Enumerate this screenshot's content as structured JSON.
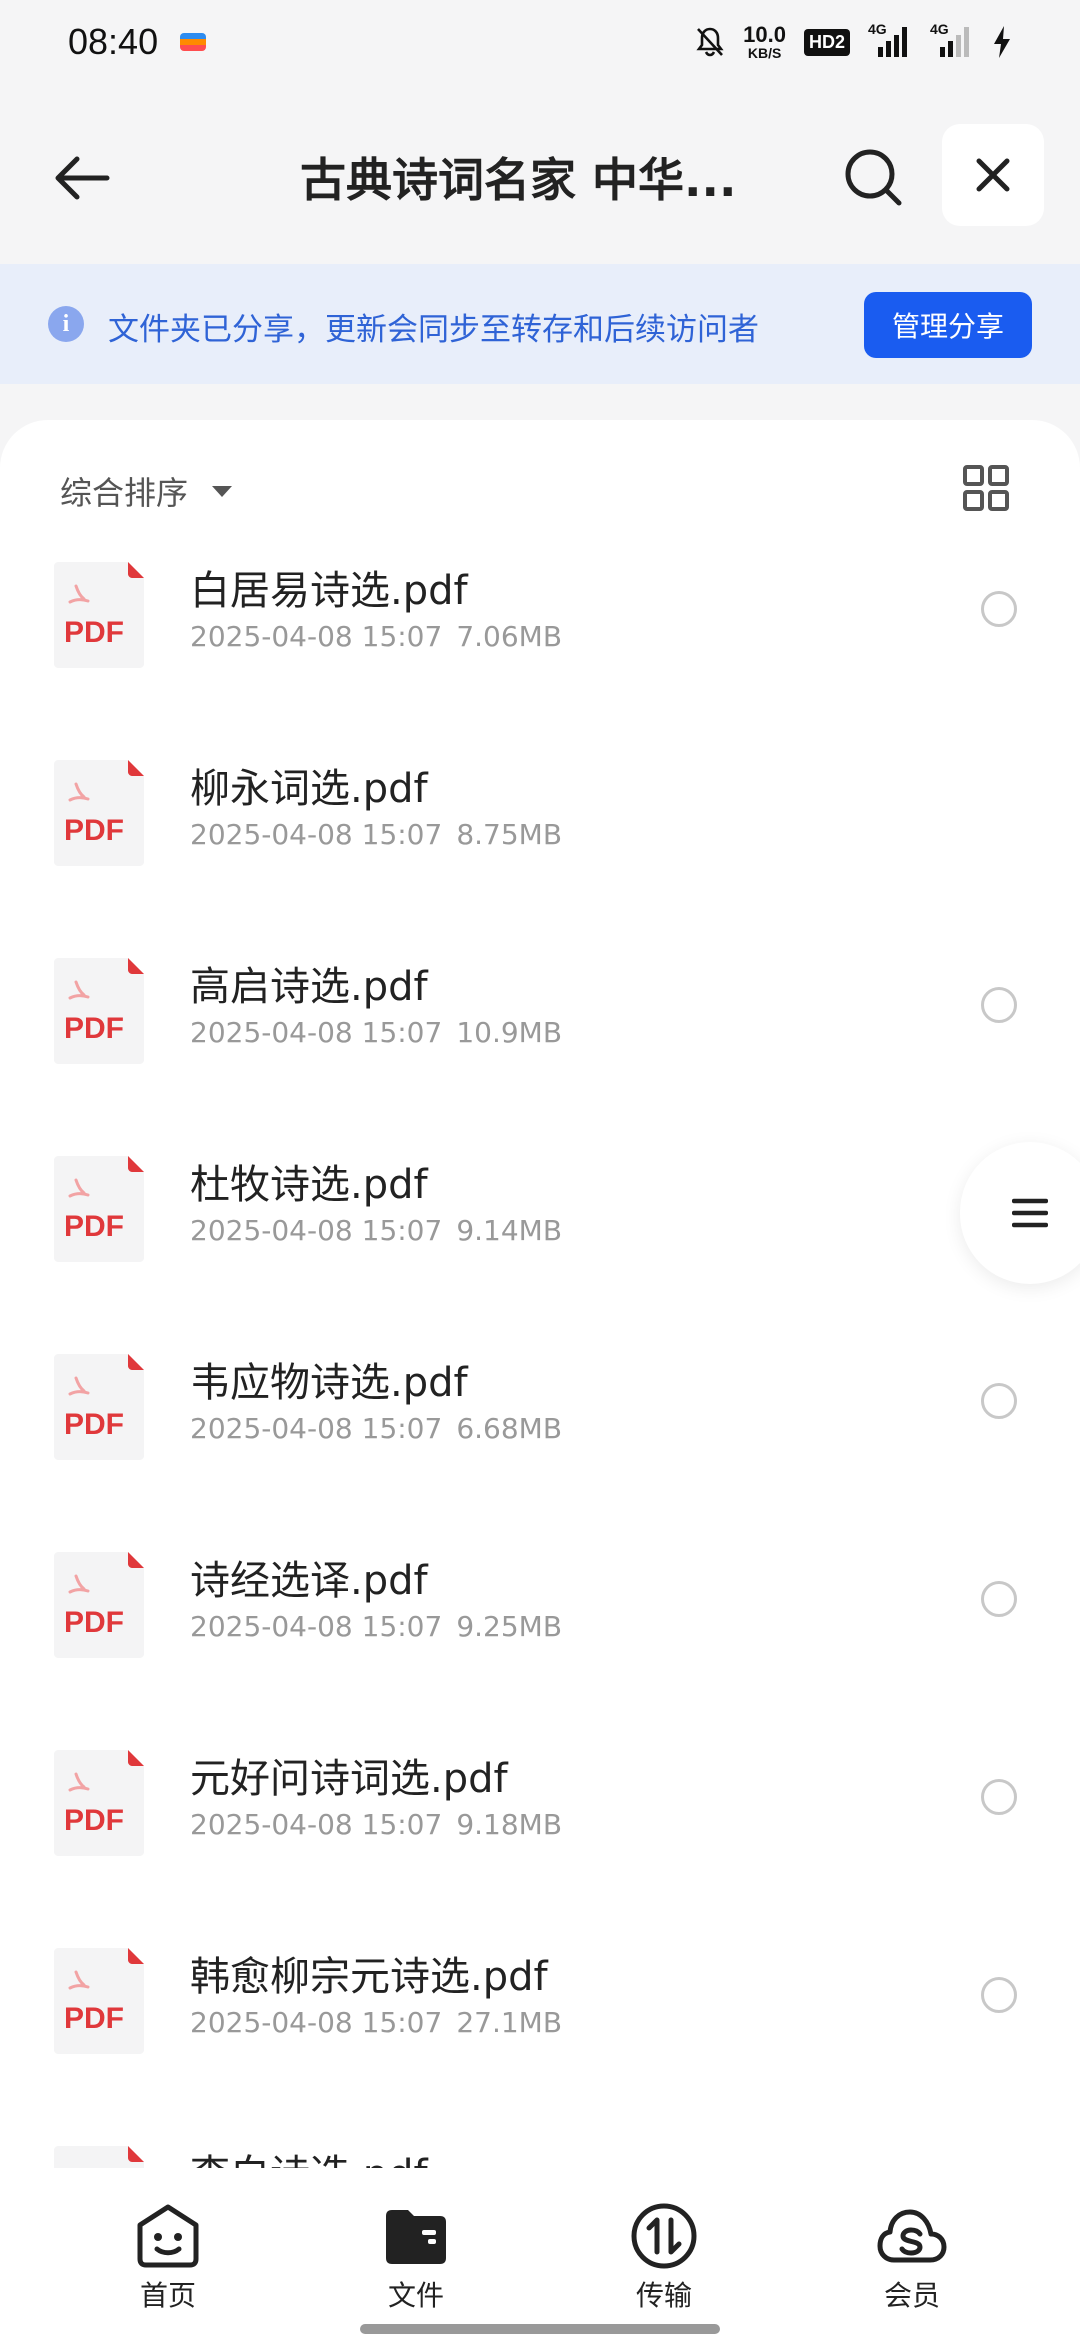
{
  "status_bar": {
    "time": "08:40",
    "speed_value": "10.0",
    "speed_unit": "KB/S",
    "hd": "HD2",
    "signal1_label": "4G",
    "signal2_label": "4G"
  },
  "header": {
    "title": "古典诗词名家 中华..."
  },
  "notice": {
    "text": "文件夹已分享，更新会同步至转存和后续访问者",
    "manage_label": "管理分享"
  },
  "sort": {
    "label": "综合排序"
  },
  "files": [
    {
      "name": "白居易诗选.pdf",
      "date": "2025-04-08 15:07",
      "size": "7.06MB"
    },
    {
      "name": "柳永词选.pdf",
      "date": "2025-04-08 15:07",
      "size": "8.75MB"
    },
    {
      "name": "高启诗选.pdf",
      "date": "2025-04-08 15:07",
      "size": "10.9MB"
    },
    {
      "name": "杜牧诗选.pdf",
      "date": "2025-04-08 15:07",
      "size": "9.14MB"
    },
    {
      "name": "韦应物诗选.pdf",
      "date": "2025-04-08 15:07",
      "size": "6.68MB"
    },
    {
      "name": "诗经选译.pdf",
      "date": "2025-04-08 15:07",
      "size": "9.25MB"
    },
    {
      "name": "元好问诗词选.pdf",
      "date": "2025-04-08 15:07",
      "size": "9.18MB"
    },
    {
      "name": "韩愈柳宗元诗选.pdf",
      "date": "2025-04-08 15:07",
      "size": "27.1MB"
    },
    {
      "name": "李白诗选.pdf",
      "date": "",
      "size": ""
    }
  ],
  "pdf_label": "PDF",
  "nav": {
    "home": "首页",
    "files": "文件",
    "transfer": "传输",
    "member": "会员"
  },
  "colors": {
    "accent": "#1a5cf0",
    "notice_bg": "#e8eefa",
    "notice_text": "#2f63d6",
    "pdf_red": "#e0383b"
  }
}
